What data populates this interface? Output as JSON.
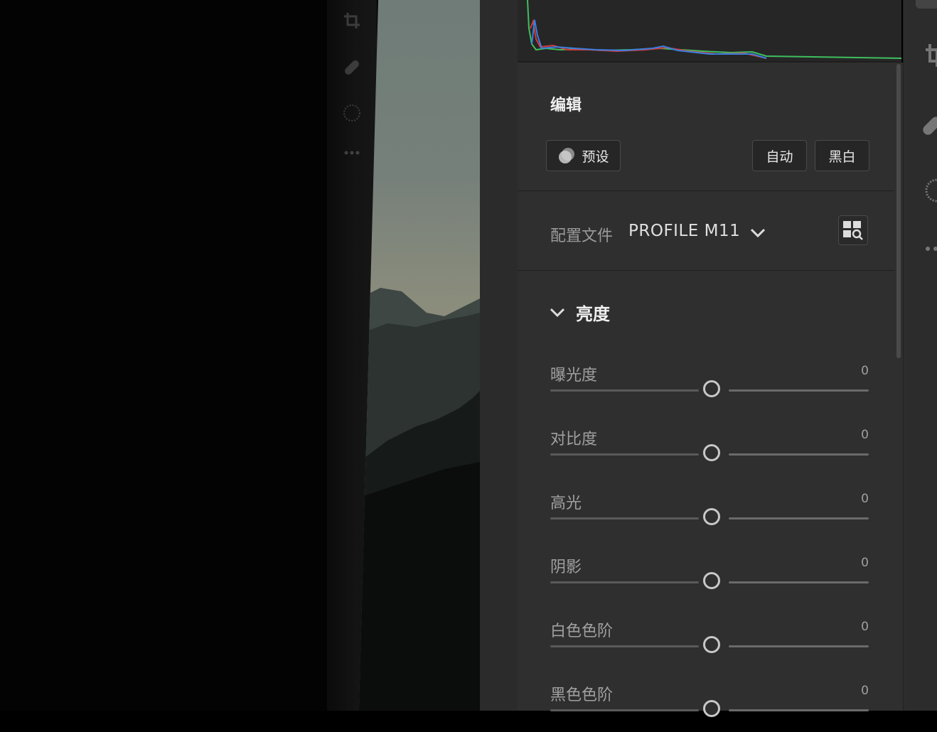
{
  "panel": {
    "section_title": "编辑",
    "buttons": {
      "presets": "预设",
      "auto": "自动",
      "bw": "黑白"
    },
    "profile": {
      "label": "配置文件",
      "value": "PROFILE M11"
    },
    "light_group": {
      "title": "亮度",
      "sliders": [
        {
          "label": "曝光度",
          "value": "0"
        },
        {
          "label": "对比度",
          "value": "0"
        },
        {
          "label": "高光",
          "value": "0"
        },
        {
          "label": "阴影",
          "value": "0"
        },
        {
          "label": "白色色阶",
          "value": "0"
        },
        {
          "label": "黑色色阶",
          "value": "0"
        }
      ]
    }
  },
  "icons": {
    "canvas_tools": [
      "crop-icon",
      "healing-icon",
      "masking-icon",
      "more-icon"
    ],
    "rail_tools": [
      "crop-icon",
      "healing-icon",
      "masking-icon",
      "more-icon"
    ],
    "presets": "presets-icon",
    "profile_expand": "chevron-down-icon",
    "profile_browse": "profile-browser-icon",
    "group_toggle": "chevron-down-icon"
  },
  "colors": {
    "panel_bg": "#2f2f2f",
    "histogram_bg": "#262626",
    "histogram_red": "#d23a3a",
    "histogram_green": "#3fbf5f",
    "histogram_blue": "#3a7fe0"
  }
}
